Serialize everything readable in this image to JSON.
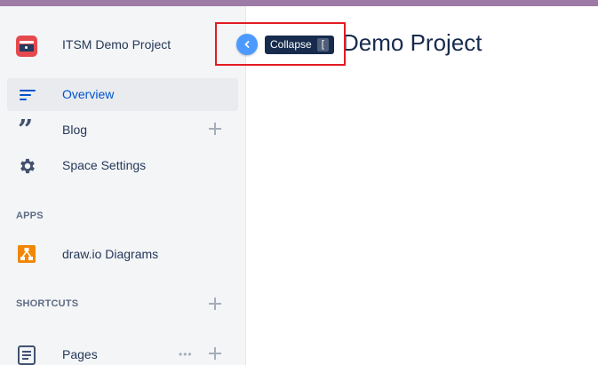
{
  "space": {
    "name": "ITSM Demo Project",
    "logo_icon": "space-logo-icon",
    "logo_color": "#e5494d"
  },
  "sidebar": {
    "items": [
      {
        "label": "Overview",
        "icon": "overview-icon",
        "active": true
      },
      {
        "label": "Blog",
        "icon": "quote-icon"
      },
      {
        "label": "Space Settings",
        "icon": "gear-icon"
      }
    ],
    "apps_title": "APPS",
    "apps": [
      {
        "label": "draw.io Diagrams",
        "icon": "drawio-icon"
      }
    ],
    "shortcuts_title": "SHORTCUTS",
    "pages": {
      "label": "Pages",
      "icon": "pages-icon"
    }
  },
  "main": {
    "title_visible": "Demo Project"
  },
  "collapse": {
    "tooltip": "Collapse",
    "shortcut": "["
  },
  "colors": {
    "accent": "#0052cc",
    "topbar": "#9e7aa6",
    "highlight": "#e31b23"
  }
}
